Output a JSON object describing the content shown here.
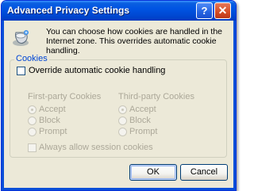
{
  "window": {
    "title": "Advanced Privacy Settings",
    "help_glyph": "?",
    "close_glyph": "✕"
  },
  "intro": {
    "icon": "privacy-settings-icon",
    "text": "You can choose how cookies are handled in the Internet zone. This overrides automatic cookie handling."
  },
  "cookies_group": {
    "legend": "Cookies",
    "override_label": "Override automatic cookie handling",
    "override_checked": false,
    "first_party": {
      "heading": "First-party Cookies",
      "options": [
        "Accept",
        "Block",
        "Prompt"
      ],
      "selected": "Accept"
    },
    "third_party": {
      "heading": "Third-party Cookies",
      "options": [
        "Accept",
        "Block",
        "Prompt"
      ],
      "selected": "Accept"
    },
    "session_label": "Always allow session cookies",
    "session_checked": false
  },
  "buttons": {
    "ok_label": "OK",
    "cancel_label": "Cancel"
  },
  "colors": {
    "titlebar": "#0054e3",
    "face": "#ece9d8",
    "group_legend": "#0046d5",
    "disabled_text": "#aca899"
  }
}
